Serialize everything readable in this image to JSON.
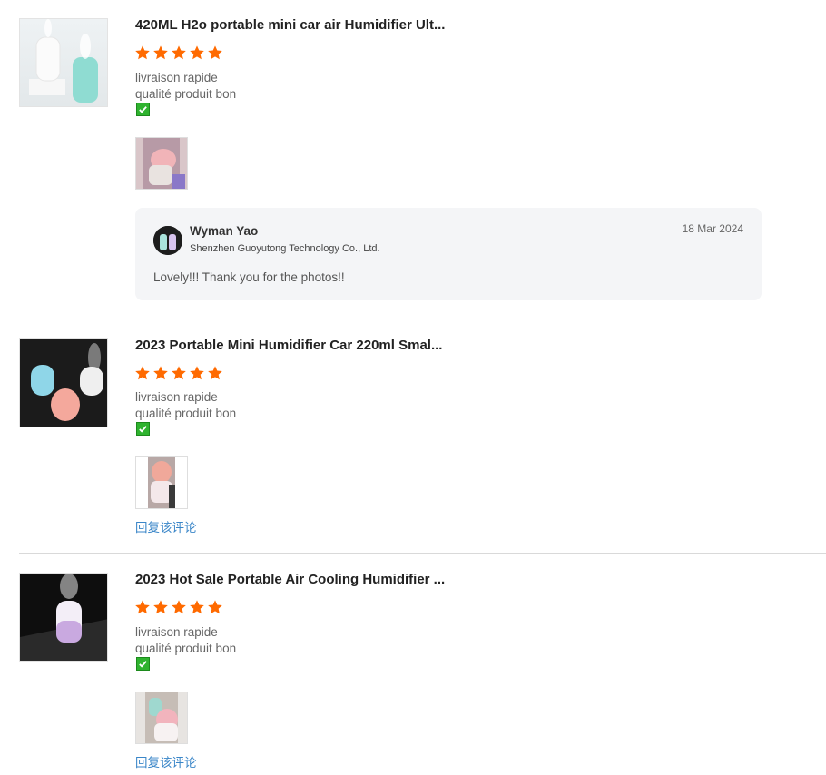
{
  "reviews": [
    {
      "product_title": "420ML H2o portable mini car air Humidifier Ult...",
      "rating": 5,
      "lines": [
        "livraison rapide",
        "qualité produit bon"
      ],
      "has_check_emoji": true,
      "photos": 1,
      "seller_reply": {
        "name": "Wyman Yao",
        "company": "Shenzhen Guoyutong Technology Co., Ltd.",
        "date": "18 Mar 2024",
        "text": "Lovely!!! Thank you for the photos!!"
      }
    },
    {
      "product_title": "2023 Portable Mini Humidifier Car 220ml Smal...",
      "rating": 5,
      "lines": [
        "livraison rapide",
        "qualité produit bon"
      ],
      "has_check_emoji": true,
      "photos": 1,
      "reply_link": "回复该评论"
    },
    {
      "product_title": "2023 Hot Sale Portable Air Cooling Humidifier ...",
      "rating": 5,
      "lines": [
        "livraison rapide",
        "qualité produit bon"
      ],
      "has_check_emoji": true,
      "photos": 1,
      "reply_link": "回复该评论"
    }
  ],
  "colors": {
    "star": "#ff6a00",
    "link": "#3a86c8",
    "check": "#2fb32f"
  }
}
